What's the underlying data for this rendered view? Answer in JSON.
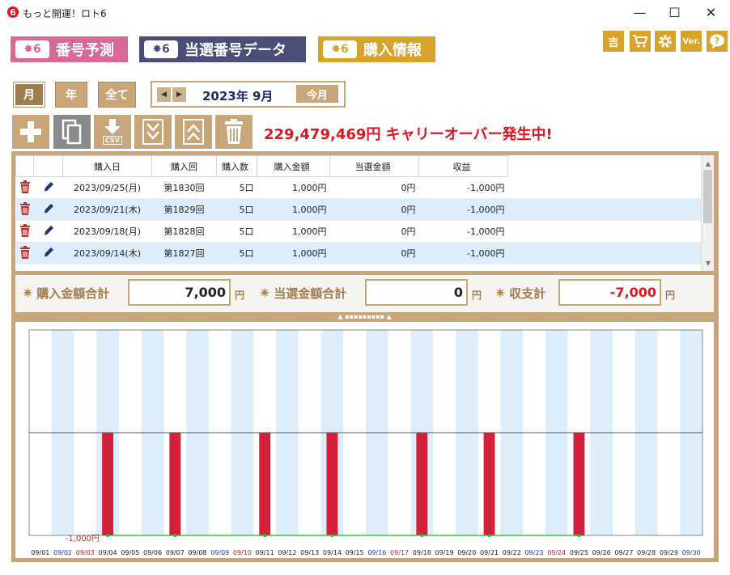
{
  "app": {
    "title": "もっと開運！ロト6",
    "icon_text": "6"
  },
  "window": {
    "minimize": "—",
    "maximize": "☐",
    "close": "✕"
  },
  "tabs": [
    {
      "badge": "6",
      "label": "番号予測",
      "color": "#d8679a"
    },
    {
      "badge": "6",
      "label": "当選番号データ",
      "color": "#4a4f7a"
    },
    {
      "badge": "6",
      "label": "購入情報",
      "color": "#d9a32b"
    }
  ],
  "tools": {
    "fortune": "吉",
    "cart": "cart-icon",
    "settings": "gear-icon",
    "version": "Ver.",
    "help": "help-icon"
  },
  "period": {
    "month": "月",
    "year": "年",
    "all": "全て",
    "current": "2023年 9月",
    "today": "今月"
  },
  "actions": {
    "add": "plus-icon",
    "copy": "copy-icon",
    "csv": "CSV",
    "down": "chevron-double-down-icon",
    "up": "chevron-double-up-icon",
    "delete": "trash-icon"
  },
  "carryover": "229,479,469円 キャリーオーバー発生中!",
  "table": {
    "headers": [
      "購入日",
      "購入回",
      "購入数",
      "購入金額",
      "当選金額",
      "収益"
    ],
    "rows": [
      {
        "date": "2023/09/25(月)",
        "round": "第1830回",
        "count": "5口",
        "amount": "1,000円",
        "win": "0円",
        "profit": "-1,000円"
      },
      {
        "date": "2023/09/21(木)",
        "round": "第1829回",
        "count": "5口",
        "amount": "1,000円",
        "win": "0円",
        "profit": "-1,000円"
      },
      {
        "date": "2023/09/18(月)",
        "round": "第1828回",
        "count": "5口",
        "amount": "1,000円",
        "win": "0円",
        "profit": "-1,000円"
      },
      {
        "date": "2023/09/14(木)",
        "round": "第1827回",
        "count": "5口",
        "amount": "1,000円",
        "win": "0円",
        "profit": "-1,000円"
      }
    ]
  },
  "summary": {
    "purchase_label": "購入金額合計",
    "purchase_value": "7,000",
    "win_label": "当選金額合計",
    "win_value": "0",
    "balance_label": "収支計",
    "balance_value": "-7,000",
    "yen": "円"
  },
  "chart_data": {
    "type": "bar",
    "ylabel_min": "-1,000円",
    "categories": [
      "09/01",
      "09/02",
      "09/03",
      "09/04",
      "09/05",
      "09/06",
      "09/07",
      "09/08",
      "09/09",
      "09/10",
      "09/11",
      "09/12",
      "09/13",
      "09/14",
      "09/15",
      "09/16",
      "09/17",
      "09/18",
      "09/19",
      "09/20",
      "09/21",
      "09/22",
      "09/23",
      "09/24",
      "09/25",
      "09/26",
      "09/27",
      "09/28",
      "09/29",
      "09/30"
    ],
    "values": [
      0,
      0,
      0,
      -1000,
      0,
      0,
      -1000,
      0,
      0,
      0,
      -1000,
      0,
      0,
      -1000,
      0,
      0,
      0,
      -1000,
      0,
      0,
      -1000,
      0,
      0,
      0,
      -1000,
      0,
      0,
      0,
      0,
      0
    ],
    "category_colors": [
      "#222",
      "#1a3bd0",
      "#d01a1a",
      "#222",
      "#222",
      "#222",
      "#222",
      "#222",
      "#1a3bd0",
      "#d01a1a",
      "#222",
      "#222",
      "#222",
      "#222",
      "#222",
      "#1a3bd0",
      "#d01a1a",
      "#222",
      "#222",
      "#222",
      "#222",
      "#222",
      "#1a3bd0",
      "#d01a1a",
      "#222",
      "#222",
      "#222",
      "#222",
      "#222",
      "#1a3bd0"
    ],
    "bar_color": "#d4203a",
    "line_color": "#22bb22",
    "ylim": [
      -1000,
      1000
    ]
  }
}
